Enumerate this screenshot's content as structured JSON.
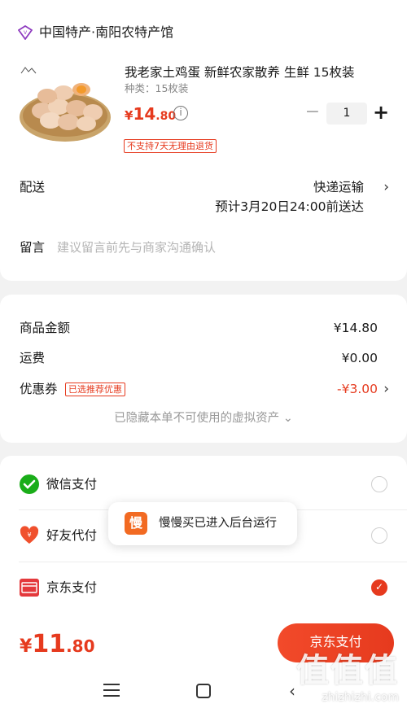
{
  "shop": {
    "name": "中国特产·南阳农特产馆",
    "icon": "diamond-shop-icon"
  },
  "product": {
    "title": "我老家土鸡蛋 新鲜农家散养 生鲜 15枚装",
    "variant": "种类：15枚装",
    "price_symbol": "¥",
    "price_int": "14",
    "price_dec": ".80",
    "info_icon": "i",
    "quantity": "1",
    "minus": "−",
    "plus": "+",
    "no_return_tag": "不支持7天无理由退货"
  },
  "delivery": {
    "label": "配送",
    "method": "快递运输",
    "eta": "预计3月20日24:00前送达",
    "arrow": "›"
  },
  "message": {
    "label": "留言",
    "placeholder": "建议留言前先与商家沟通确认"
  },
  "price_breakdown": {
    "goods_label": "商品金额",
    "goods_value": "¥14.80",
    "shipping_label": "运费",
    "shipping_value": "¥0.00",
    "coupon_label": "优惠券",
    "coupon_tag": "已选推荐优惠",
    "coupon_value": "-¥3.00",
    "coupon_arrow": "›",
    "hidden_note": "已隐藏本单不可使用的虚拟资产 ⌄"
  },
  "payment": {
    "options": [
      {
        "label": "微信支付",
        "icon": "wechat-pay-icon",
        "selected": false
      },
      {
        "label": "好友代付",
        "icon": "friend-pay-icon",
        "selected": false
      },
      {
        "label": "京东支付",
        "icon": "jd-pay-icon",
        "selected": true
      }
    ],
    "check_mark": "✓"
  },
  "toast": {
    "icon_text": "慢",
    "text": "慢慢买已进入后台运行"
  },
  "footer": {
    "total_symbol": "¥",
    "total_int": "11",
    "total_dec": ".80",
    "pay_button": "京东支付"
  },
  "watermark": {
    "main": "值值值",
    "sub": "zhizhizhi.com"
  },
  "colors": {
    "accent": "#e63a1e",
    "wechat": "#1aad19",
    "friend_pay": "#f0502d",
    "jd_pay": "#e4393c"
  }
}
